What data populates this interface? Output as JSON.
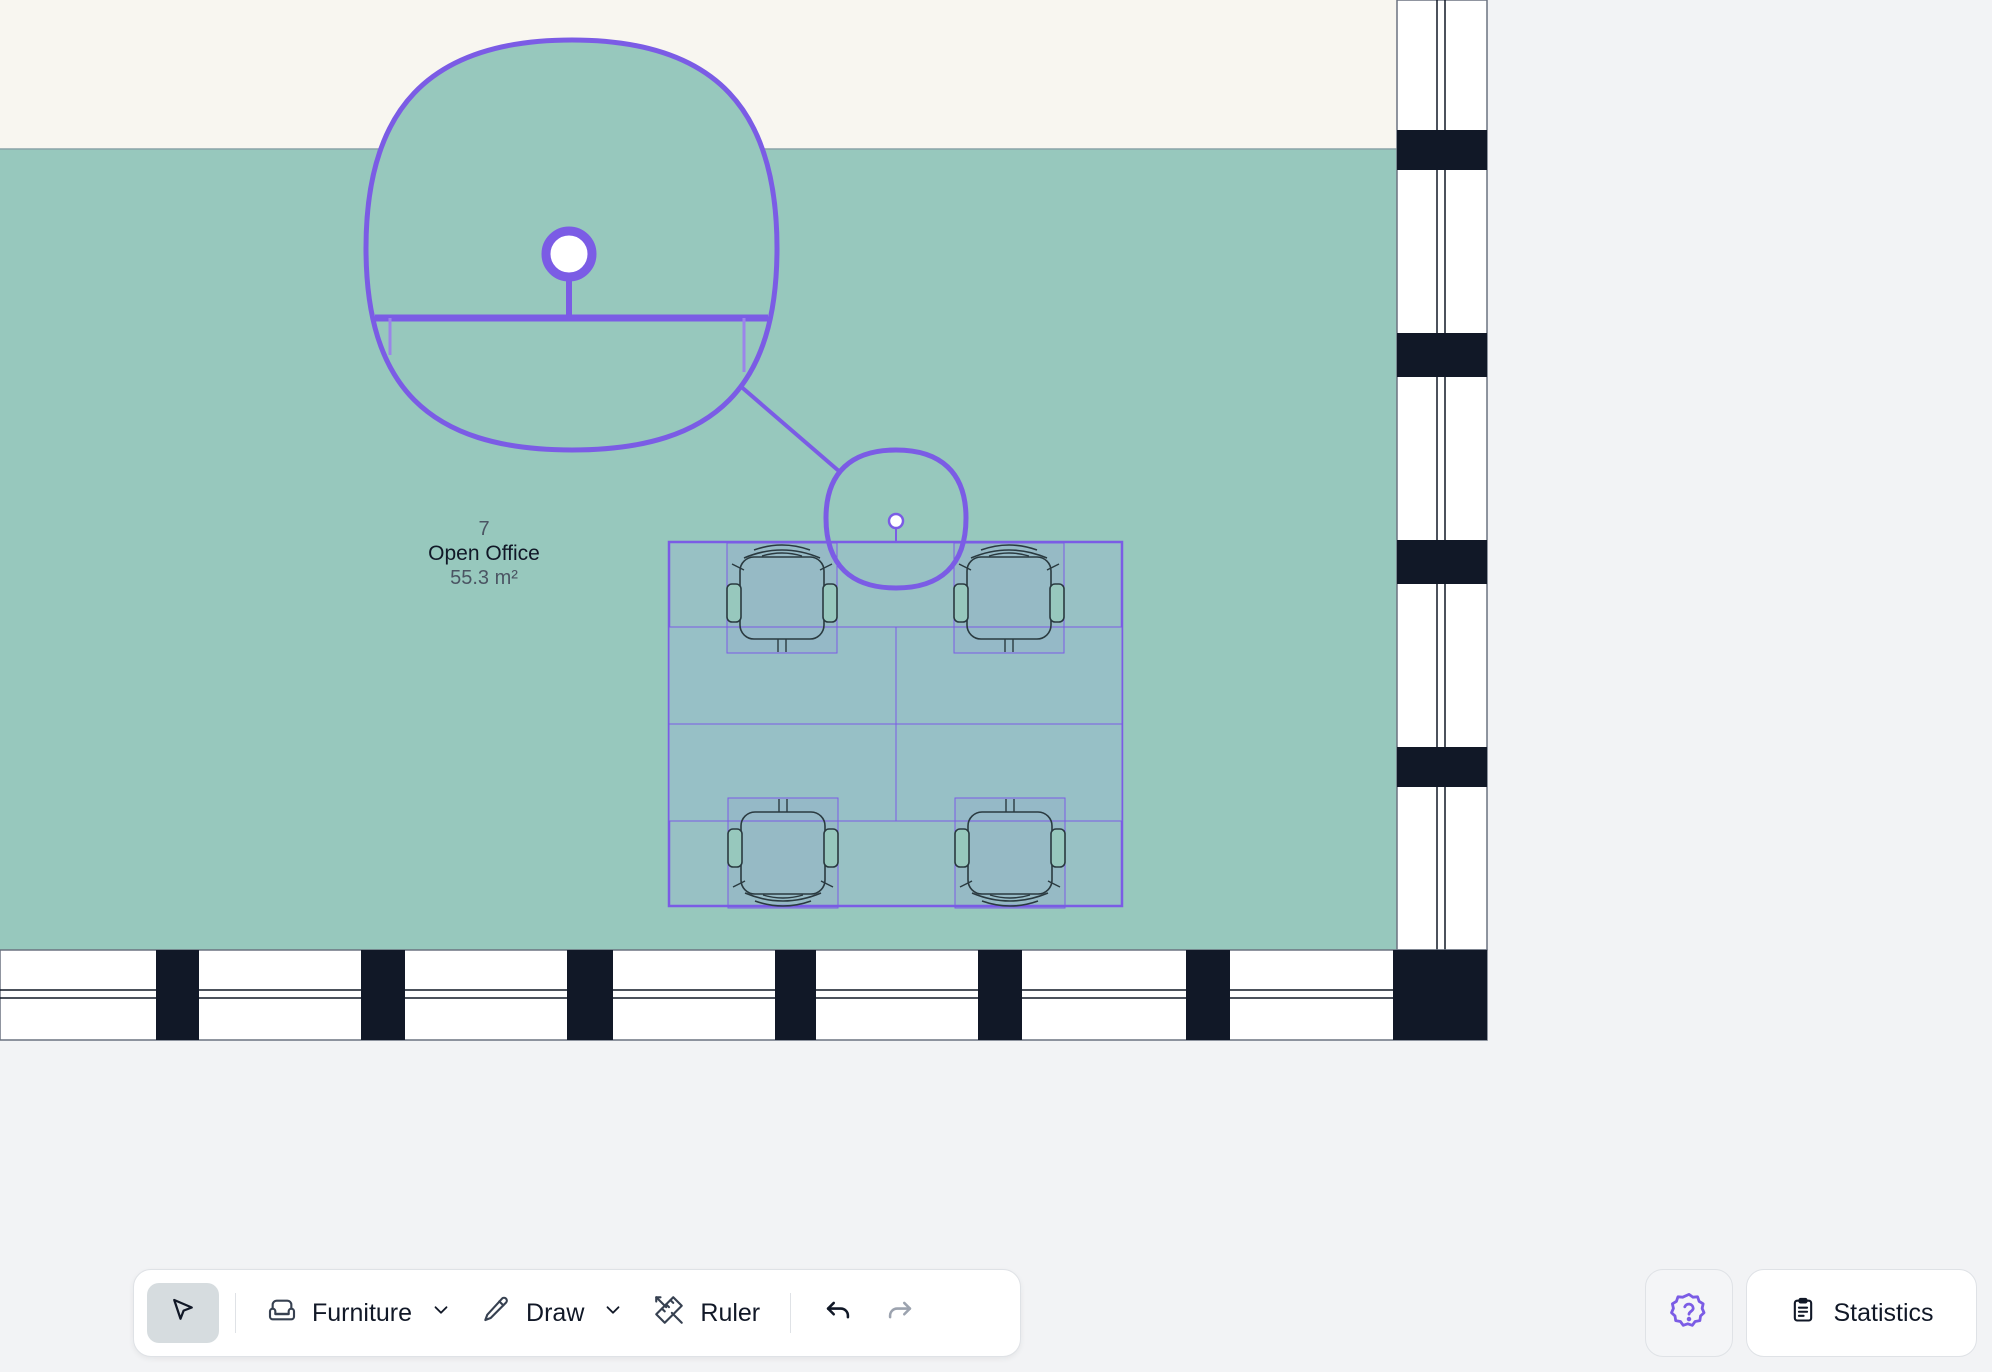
{
  "room": {
    "number": "7",
    "name": "Open Office",
    "area": "55.3 m²"
  },
  "toolbar": {
    "furniture_label": "Furniture",
    "draw_label": "Draw",
    "ruler_label": "Ruler"
  },
  "statistics_label": "Statistics",
  "icons": {
    "select": "cursor-arrow-icon",
    "furniture": "sofa-icon",
    "draw": "pencil-icon",
    "ruler": "ruler-icon",
    "undo": "undo-icon",
    "redo": "redo-icon",
    "help": "help-badge-icon",
    "statistics": "clipboard-icon"
  },
  "colors": {
    "room_fill": "#97c8bd",
    "outside_fill": "#f8f6f0",
    "wall_dark": "#111827",
    "selection": "#7b5ce5",
    "background": "#f2f3f5"
  }
}
